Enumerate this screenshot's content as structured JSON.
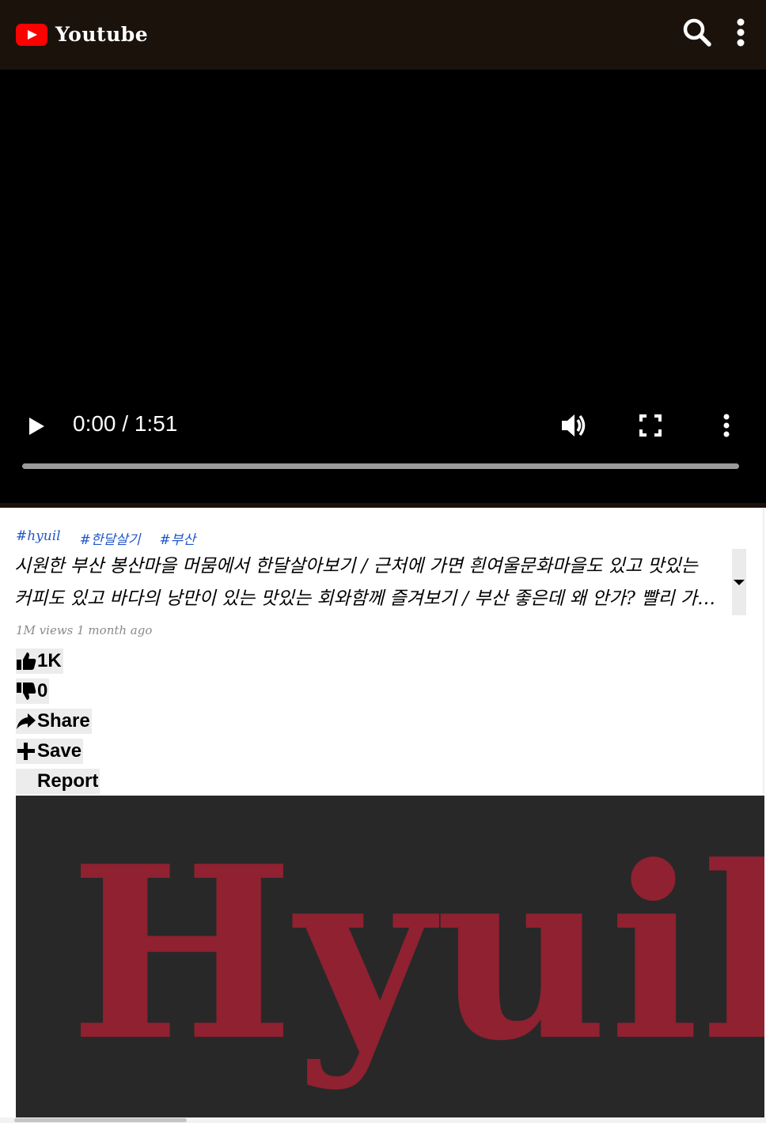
{
  "app": {
    "title": "Youtube",
    "brand_color": "#ff0000"
  },
  "header": {
    "search_icon": "search-icon",
    "more_icon": "more-vertical-icon"
  },
  "player": {
    "time": "0:00 / 1:51",
    "progress": 0.0,
    "controls": [
      "play-icon",
      "volume-icon",
      "fullscreen-icon",
      "more-vertical-icon"
    ]
  },
  "video": {
    "tags": [
      "#hyuil",
      "#한달살기",
      "#부산"
    ],
    "title": "시원한 부산 봉산마을 머뭄에서 한달살아보기 / 근처에 가면 흰여울문화마을도 있고 맛있는 커피도 있고 바다의 낭만이 있는 맛있는 회와함께 즐겨보기 / 부산 좋은데 왜 안가? 빨리 가보자",
    "meta": "1M views 1 month ago",
    "actions": {
      "like": "1K",
      "dislike": "0",
      "share": "Share",
      "save": "Save",
      "report": "Report"
    },
    "thumbnail_text": "Hyuil",
    "tag_color": "#2257c9",
    "thumbnail_text_color": "#8f2130"
  }
}
